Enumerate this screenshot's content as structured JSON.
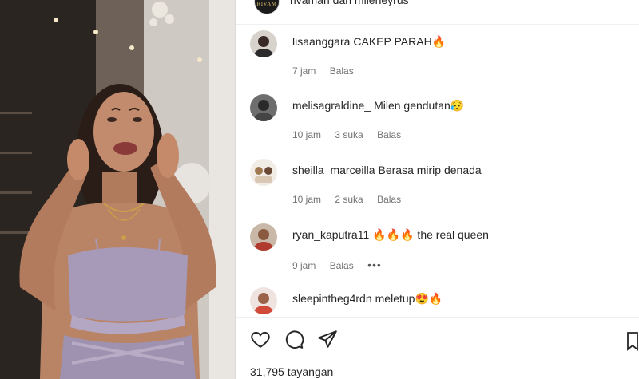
{
  "post": {
    "liked_by": "rivamarl dan mileneyrus",
    "avatar_text": "RIVAM",
    "views": "31,795 tayangan"
  },
  "comments": [
    {
      "username": "lisaanggara",
      "text": "CAKEP PARAH🔥",
      "time": "7 jam",
      "likes": "",
      "reply": "Balas"
    },
    {
      "username": "melisagraldine_",
      "text": "Milen gendutan😥",
      "time": "10 jam",
      "likes": "3 suka",
      "reply": "Balas"
    },
    {
      "username": "sheilla_marceilla",
      "text": "Berasa mirip denada",
      "time": "10 jam",
      "likes": "2 suka",
      "reply": "Balas"
    },
    {
      "username": "ryan_kaputra11",
      "text": "🔥🔥🔥 the real queen",
      "time": "9 jam",
      "likes": "",
      "reply": "Balas"
    },
    {
      "username": "sleepintheg4rdn",
      "text": "meletup😍🔥",
      "time": "",
      "likes": "",
      "reply": ""
    }
  ],
  "icons": {
    "like": "heart-icon",
    "comment": "comment-icon",
    "share": "share-icon",
    "save": "bookmark-icon",
    "more": "more-dots-icon"
  },
  "colors": {
    "text": "#262626",
    "secondary": "#737373",
    "border": "#dbdbdb"
  }
}
